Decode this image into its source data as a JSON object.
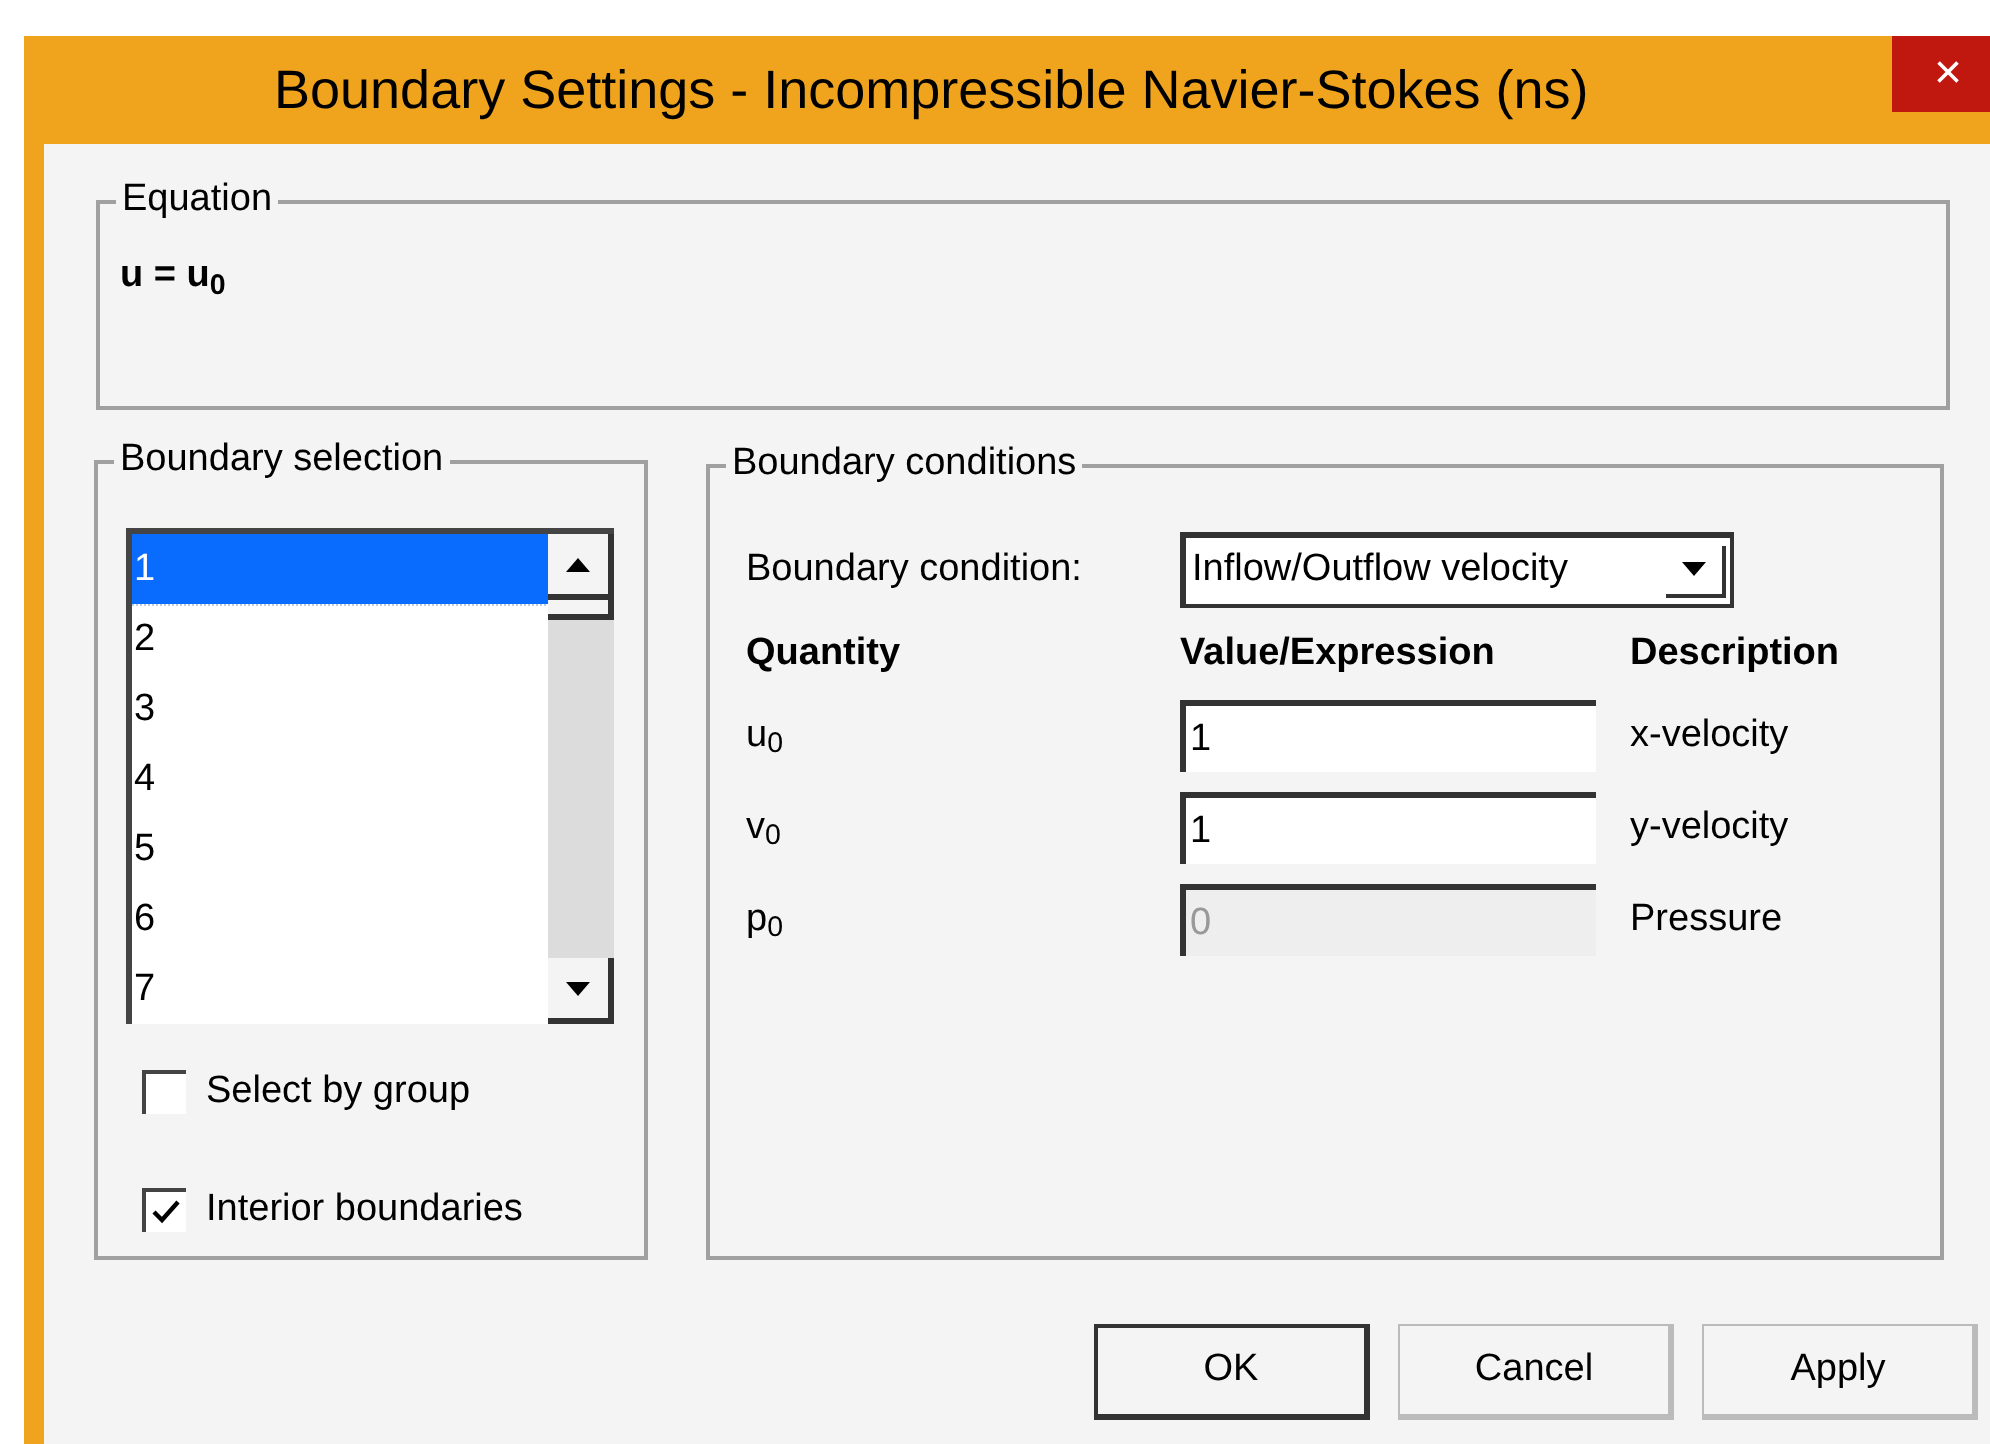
{
  "window": {
    "title": "Boundary Settings - Incompressible Navier-Stokes (ns)",
    "close": "×"
  },
  "equation": {
    "label": "Equation",
    "formula": "u = u$_{0}$"
  },
  "boundary_selection": {
    "label": "Boundary selection",
    "items": [
      {
        "label": "1",
        "selected": true
      },
      {
        "label": "2",
        "selected": false
      },
      {
        "label": "3",
        "selected": false
      },
      {
        "label": "4",
        "selected": false
      },
      {
        "label": "5",
        "selected": false
      },
      {
        "label": "6",
        "selected": false
      },
      {
        "label": "7",
        "selected": false
      }
    ],
    "checkboxes": [
      {
        "label": "Select by group",
        "checked": false
      },
      {
        "label": "Interior boundaries",
        "checked": true
      }
    ]
  },
  "boundary_conditions": {
    "label": "Boundary conditions",
    "condition_label": "Boundary condition:",
    "condition_value": "Inflow/Outflow velocity",
    "columns": [
      "Quantity",
      "Value/Expression",
      "Description"
    ],
    "rows": [
      {
        "quantity": "u$_{0}$",
        "value": "1",
        "description": "x-velocity",
        "disabled": false
      },
      {
        "quantity": "v$_{0}$",
        "value": "1",
        "description": "y-velocity",
        "disabled": false
      },
      {
        "quantity": "p$_{0}$",
        "value": "0",
        "description": "Pressure",
        "disabled": true
      }
    ]
  },
  "buttons": [
    {
      "label": "OK",
      "default": true
    },
    {
      "label": "Cancel",
      "default": false
    },
    {
      "label": "Apply",
      "default": false
    }
  ]
}
